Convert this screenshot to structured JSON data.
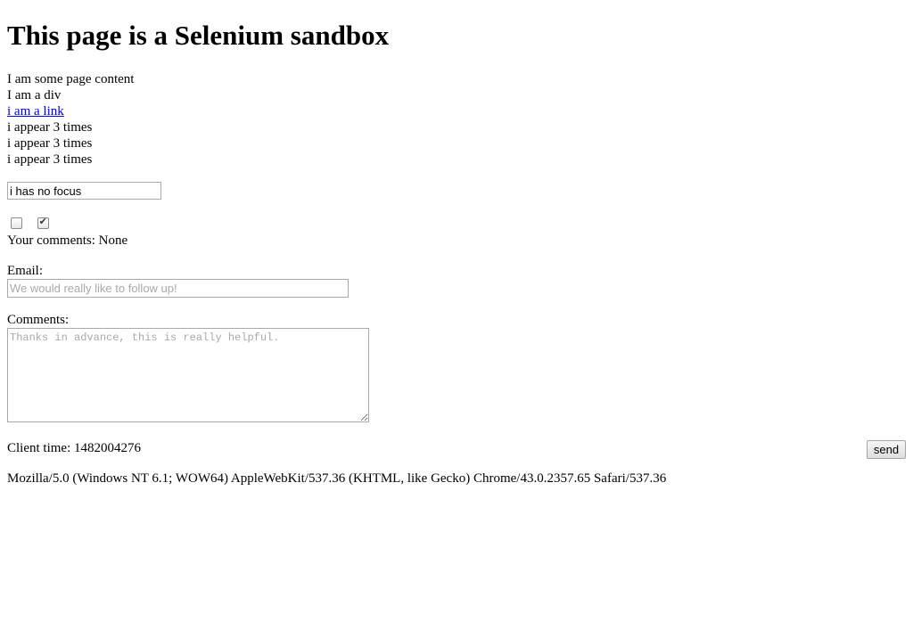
{
  "page": {
    "heading": "This page is a Selenium sandbox"
  },
  "content": {
    "page_content_text": "I am some page content",
    "div_text": "I am a div",
    "link_text": "i am a link",
    "repeated_lines": [
      "i appear 3 times",
      "i appear 3 times",
      "i appear 3 times"
    ]
  },
  "focus_input": {
    "value": "i has no focus"
  },
  "checkboxes": [
    {
      "checked": false
    },
    {
      "checked": true
    }
  ],
  "comments_status": "Your comments: None",
  "email": {
    "label": "Email:",
    "placeholder": "We would really like to follow up!"
  },
  "comments": {
    "label": "Comments:",
    "placeholder": "Thanks in advance, this is really helpful."
  },
  "client_time": "Client time: 1482004276",
  "send_button": {
    "label": "send"
  },
  "user_agent": "Mozilla/5.0 (Windows NT 6.1; WOW64) AppleWebKit/537.36 (KHTML, like Gecko) Chrome/43.0.2357.65 Safari/537.36"
}
